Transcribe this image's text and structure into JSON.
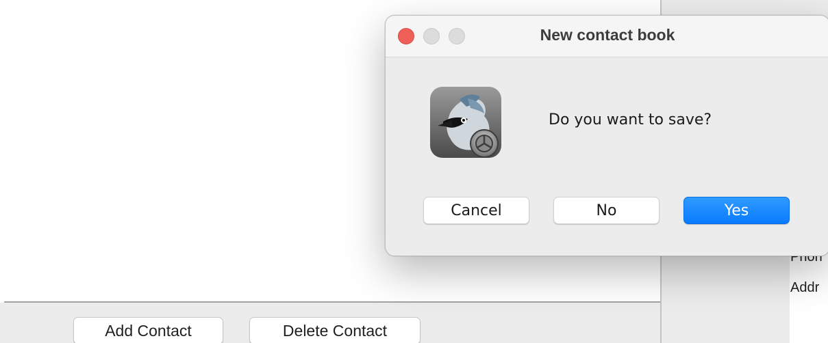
{
  "app": {
    "buttons": {
      "add_contact": "Add Contact",
      "delete_contact": "Delete Contact"
    },
    "detail_labels": {
      "phone": "Phon",
      "address": "Addr"
    }
  },
  "dialog": {
    "title": "New contact book",
    "message": "Do you want to save?",
    "icon": "java-duke-bird-app-icon",
    "buttons": {
      "cancel": "Cancel",
      "no": "No",
      "yes": "Yes"
    },
    "default_button_color": "#0a7bff",
    "close_button_color": "#ee5f57"
  }
}
